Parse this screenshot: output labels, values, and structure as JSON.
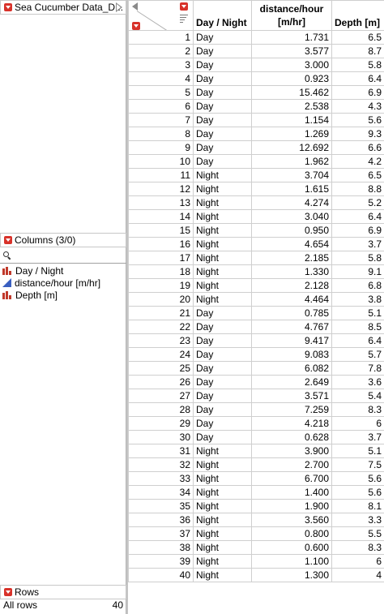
{
  "table_panel": {
    "title": "Sea Cucumber Data_D..."
  },
  "columns_panel": {
    "title": "Columns (3/0)",
    "items": [
      {
        "label": "Day / Night",
        "icon": "nominal-icon"
      },
      {
        "label": "distance/hour [m/hr]",
        "icon": "continuous-icon"
      },
      {
        "label": "Depth [m]",
        "icon": "nominal-icon"
      }
    ]
  },
  "rows_panel": {
    "title": "Rows",
    "all_rows_label": "All rows",
    "all_rows_value": "40"
  },
  "colors": {
    "accent_red": "#d8322a",
    "continuous_blue": "#3a5fc0",
    "nominal_red": "#c0392b"
  },
  "grid": {
    "headers": {
      "day_night": "Day / Night",
      "distance_line1": "distance/hour",
      "distance_line2": "[m/hr]",
      "depth": "Depth [m]"
    },
    "rows": [
      {
        "n": "1",
        "dn": "Day",
        "dist": "1.731",
        "depth": "6.5"
      },
      {
        "n": "2",
        "dn": "Day",
        "dist": "3.577",
        "depth": "8.7"
      },
      {
        "n": "3",
        "dn": "Day",
        "dist": "3.000",
        "depth": "5.8"
      },
      {
        "n": "4",
        "dn": "Day",
        "dist": "0.923",
        "depth": "6.4"
      },
      {
        "n": "5",
        "dn": "Day",
        "dist": "15.462",
        "depth": "6.9"
      },
      {
        "n": "6",
        "dn": "Day",
        "dist": "2.538",
        "depth": "4.3"
      },
      {
        "n": "7",
        "dn": "Day",
        "dist": "1.154",
        "depth": "5.6"
      },
      {
        "n": "8",
        "dn": "Day",
        "dist": "1.269",
        "depth": "9.3"
      },
      {
        "n": "9",
        "dn": "Day",
        "dist": "12.692",
        "depth": "6.6"
      },
      {
        "n": "10",
        "dn": "Day",
        "dist": "1.962",
        "depth": "4.2"
      },
      {
        "n": "11",
        "dn": "Night",
        "dist": "3.704",
        "depth": "6.5"
      },
      {
        "n": "12",
        "dn": "Night",
        "dist": "1.615",
        "depth": "8.8"
      },
      {
        "n": "13",
        "dn": "Night",
        "dist": "4.274",
        "depth": "5.2"
      },
      {
        "n": "14",
        "dn": "Night",
        "dist": "3.040",
        "depth": "6.4"
      },
      {
        "n": "15",
        "dn": "Night",
        "dist": "0.950",
        "depth": "6.9"
      },
      {
        "n": "16",
        "dn": "Night",
        "dist": "4.654",
        "depth": "3.7"
      },
      {
        "n": "17",
        "dn": "Night",
        "dist": "2.185",
        "depth": "5.8"
      },
      {
        "n": "18",
        "dn": "Night",
        "dist": "1.330",
        "depth": "9.1"
      },
      {
        "n": "19",
        "dn": "Night",
        "dist": "2.128",
        "depth": "6.8"
      },
      {
        "n": "20",
        "dn": "Night",
        "dist": "4.464",
        "depth": "3.8"
      },
      {
        "n": "21",
        "dn": "Day",
        "dist": "0.785",
        "depth": "5.1"
      },
      {
        "n": "22",
        "dn": "Day",
        "dist": "4.767",
        "depth": "8.5"
      },
      {
        "n": "23",
        "dn": "Day",
        "dist": "9.417",
        "depth": "6.4"
      },
      {
        "n": "24",
        "dn": "Day",
        "dist": "9.083",
        "depth": "5.7"
      },
      {
        "n": "25",
        "dn": "Day",
        "dist": "6.082",
        "depth": "7.8"
      },
      {
        "n": "26",
        "dn": "Day",
        "dist": "2.649",
        "depth": "3.6"
      },
      {
        "n": "27",
        "dn": "Day",
        "dist": "3.571",
        "depth": "5.4"
      },
      {
        "n": "28",
        "dn": "Day",
        "dist": "7.259",
        "depth": "8.3"
      },
      {
        "n": "29",
        "dn": "Day",
        "dist": "4.218",
        "depth": "6"
      },
      {
        "n": "30",
        "dn": "Day",
        "dist": "0.628",
        "depth": "3.7"
      },
      {
        "n": "31",
        "dn": "Night",
        "dist": "3.900",
        "depth": "5.1"
      },
      {
        "n": "32",
        "dn": "Night",
        "dist": "2.700",
        "depth": "7.5"
      },
      {
        "n": "33",
        "dn": "Night",
        "dist": "6.700",
        "depth": "5.6"
      },
      {
        "n": "34",
        "dn": "Night",
        "dist": "1.400",
        "depth": "5.6"
      },
      {
        "n": "35",
        "dn": "Night",
        "dist": "1.900",
        "depth": "8.1"
      },
      {
        "n": "36",
        "dn": "Night",
        "dist": "3.560",
        "depth": "3.3"
      },
      {
        "n": "37",
        "dn": "Night",
        "dist": "0.800",
        "depth": "5.5"
      },
      {
        "n": "38",
        "dn": "Night",
        "dist": "0.600",
        "depth": "8.3"
      },
      {
        "n": "39",
        "dn": "Night",
        "dist": "1.100",
        "depth": "6"
      },
      {
        "n": "40",
        "dn": "Night",
        "dist": "1.300",
        "depth": "4"
      }
    ]
  }
}
